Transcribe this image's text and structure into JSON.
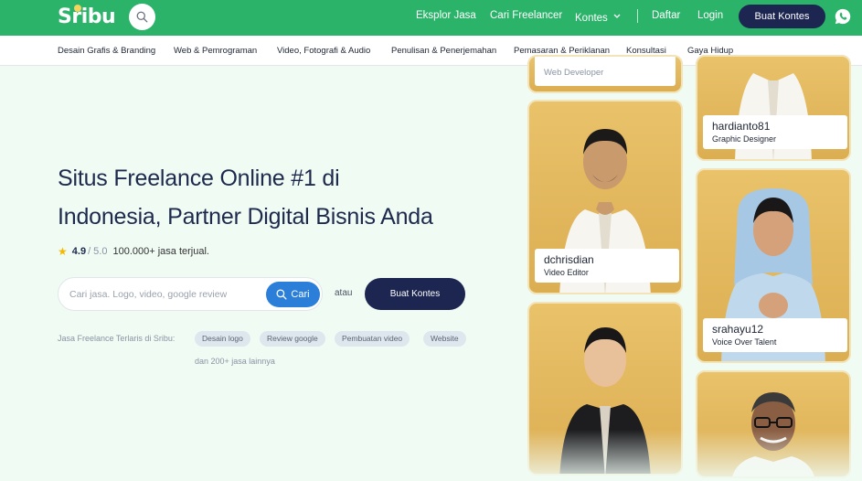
{
  "brand": {
    "logo_text": "Sribu"
  },
  "topnav": {
    "explore": "Eksplor Jasa",
    "find_freelancer": "Cari Freelancer",
    "contest": "Kontes",
    "register": "Daftar",
    "login": "Login",
    "create_contest": "Buat Kontes"
  },
  "categories": [
    "Desain Grafis & Branding",
    "Web & Pemrograman",
    "Video, Fotografi & Audio",
    "Penulisan & Penerjemahan",
    "Pemasaran & Periklanan",
    "Konsultasi",
    "Gaya Hidup"
  ],
  "hero": {
    "title_line1": "Situs Freelance Online #1 di",
    "title_line2": "Indonesia, Partner Digital Bisnis Anda",
    "rating_score": "4.9",
    "rating_outof": "/ 5.0",
    "sold_text": "100.000+ jasa terjual.",
    "search_placeholder": "Cari jasa. Logo, video, google review",
    "search_button": "Cari",
    "or_text": "atau",
    "contest_button": "Buat Kontes",
    "popular_label": "Jasa Freelance Terlaris di Sribu:",
    "popular_tags": [
      "Desain logo",
      "Review google",
      "Pembuatan video",
      "Website"
    ],
    "more_text": "dan 200+ jasa lainnya"
  },
  "freelancers": [
    {
      "name": "",
      "role": "Web Developer"
    },
    {
      "name": "hardianto81",
      "role": "Graphic Designer"
    },
    {
      "name": "dchrisdian",
      "role": "Video Editor"
    },
    {
      "name": "srahayu12",
      "role": "Voice Over Talent"
    },
    {
      "name": "",
      "role": ""
    },
    {
      "name": "",
      "role": ""
    }
  ],
  "colors": {
    "primary_green": "#2bb36a",
    "navy": "#1c2650",
    "search_blue": "#2b7fd9",
    "card_gold": "#e2b85c",
    "page_bg": "#f0fbf4"
  }
}
